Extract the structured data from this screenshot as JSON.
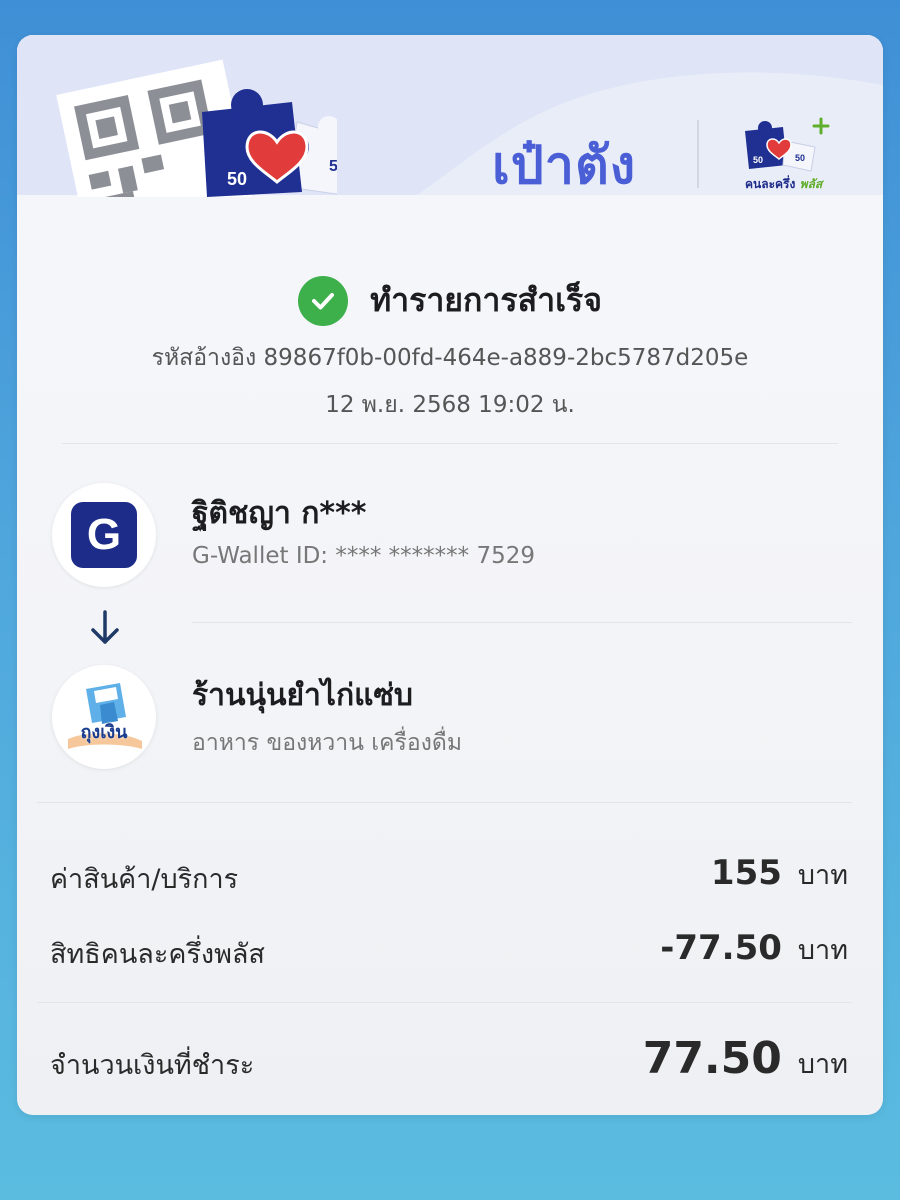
{
  "header": {
    "brand_title": "เป๋าตัง",
    "campaign_logo_text": "คนละครึ่ง",
    "campaign_logo_plus": "พลัส",
    "puzzle_value_left": "50",
    "puzzle_value_right": "50"
  },
  "status": {
    "title": "ทำรายการสำเร็จ",
    "reference": "รหัสอ้างอิง 89867f0b-00fd-464e-a889-2bc5787d205e",
    "datetime": "12 พ.ย. 2568 19:02 น."
  },
  "sender": {
    "name": "ฐิติชญา ก***",
    "wallet_id": "G-Wallet ID: **** ******* 7529",
    "logo_letter": "G"
  },
  "receiver": {
    "name": "ร้านนุ่นยำไก่แซ่บ",
    "category": "อาหาร ของหวาน เครื่องดื่ม",
    "logo_text": "ถุงเงิน"
  },
  "summary": {
    "rows": [
      {
        "label": "ค่าสินค้า/บริการ",
        "amount": "155",
        "unit": "บาท"
      },
      {
        "label": "สิทธิคนละครึ่งพลัส",
        "amount": "-77.50",
        "unit": "บาท"
      }
    ],
    "total": {
      "label": "จำนวนเงินที่ชำระ",
      "amount": "77.50",
      "unit": "บาท"
    }
  },
  "colors": {
    "brand": "#4a5fd6",
    "success": "#3db04b",
    "navy": "#1c2c88"
  }
}
